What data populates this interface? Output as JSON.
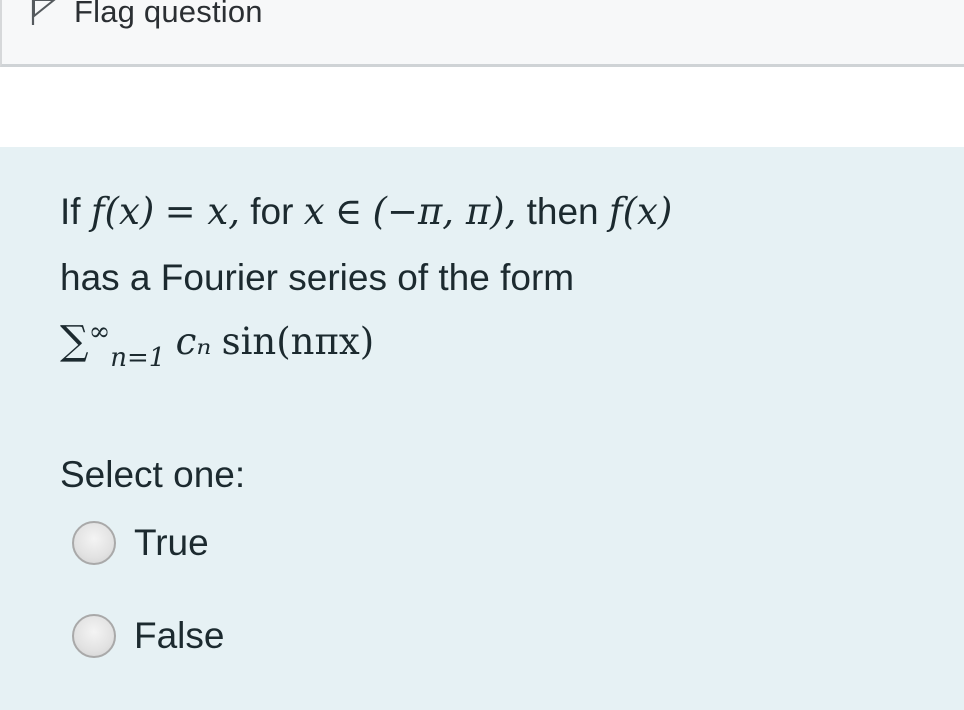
{
  "info": {
    "flag_label": "Flag question",
    "flag_icon": "flag-icon"
  },
  "question": {
    "line1": {
      "if": "If",
      "fx": "f(x)",
      "eq_x": "= x,",
      "for": "for",
      "x": "x",
      "in": "∈",
      "interval": "(−π, π),",
      "then": "then",
      "fx2": "f(x)"
    },
    "line2": "has a Fourier series of the form",
    "line3": {
      "sigma": "∑",
      "sup": "∞",
      "sub": "n=1",
      "cn": "cₙ",
      "sin": "sin(nπx)"
    }
  },
  "select_one_label": "Select one:",
  "options": [
    {
      "label": "True",
      "selected": false
    },
    {
      "label": "False",
      "selected": false
    }
  ],
  "colors": {
    "question_background": "#e6f1f4",
    "info_background": "#f7f8f9",
    "text": "#1c2a2f"
  }
}
